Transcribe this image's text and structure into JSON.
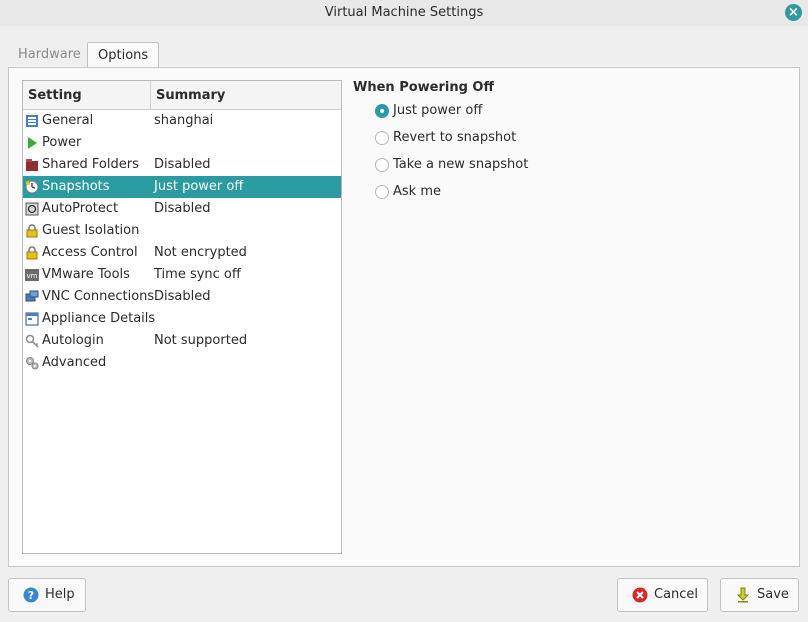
{
  "window": {
    "title": "Virtual Machine Settings",
    "close_icon": "close-icon",
    "accent": "#2a9ba0"
  },
  "tabs": [
    {
      "label": "Hardware",
      "active": false
    },
    {
      "label": "Options",
      "active": true
    }
  ],
  "settings_list": {
    "headers": {
      "setting": "Setting",
      "summary": "Summary"
    },
    "rows": [
      {
        "name": "General",
        "summary": "shanghai",
        "icon": "general-icon"
      },
      {
        "name": "Power",
        "summary": "",
        "icon": "power-icon"
      },
      {
        "name": "Shared Folders",
        "summary": "Disabled",
        "icon": "shared-folders-icon"
      },
      {
        "name": "Snapshots",
        "summary": "Just power off",
        "icon": "snapshots-icon",
        "selected": true
      },
      {
        "name": "AutoProtect",
        "summary": "Disabled",
        "icon": "autoprotect-icon"
      },
      {
        "name": "Guest Isolation",
        "summary": "",
        "icon": "lock-icon"
      },
      {
        "name": "Access Control",
        "summary": "Not encrypted",
        "icon": "lock-icon"
      },
      {
        "name": "VMware Tools",
        "summary": "Time sync off",
        "icon": "vmware-tools-icon"
      },
      {
        "name": "VNC Connections",
        "summary": "Disabled",
        "icon": "vnc-icon"
      },
      {
        "name": "Appliance Details",
        "summary": "",
        "icon": "appliance-icon"
      },
      {
        "name": "Autologin",
        "summary": "Not supported",
        "icon": "key-icon"
      },
      {
        "name": "Advanced",
        "summary": "",
        "icon": "gears-icon"
      }
    ]
  },
  "powering_off": {
    "title": "When Powering Off",
    "options": [
      {
        "label": "Just power off",
        "checked": true
      },
      {
        "label": "Revert to snapshot",
        "checked": false
      },
      {
        "label": "Take a new snapshot",
        "checked": false
      },
      {
        "label": "Ask me",
        "checked": false
      }
    ]
  },
  "footer": {
    "help_label": "Help",
    "cancel_label": "Cancel",
    "save_label": "Save"
  }
}
